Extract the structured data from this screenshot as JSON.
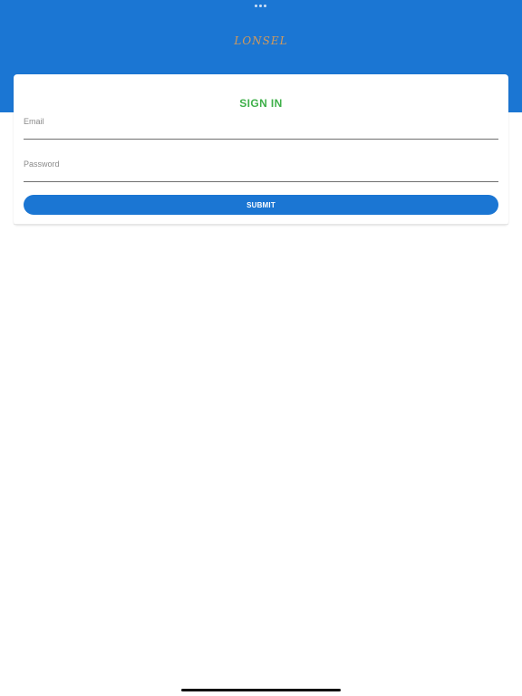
{
  "header": {
    "logo_text": "LONSEL"
  },
  "signin": {
    "title": "SIGN IN",
    "email_placeholder": "Email",
    "password_placeholder": "Password",
    "submit_label": "SUBMIT"
  },
  "colors": {
    "header_blue": "#1b76d3",
    "title_green": "#3fb04a",
    "logo_gold": "#d49a5a"
  }
}
